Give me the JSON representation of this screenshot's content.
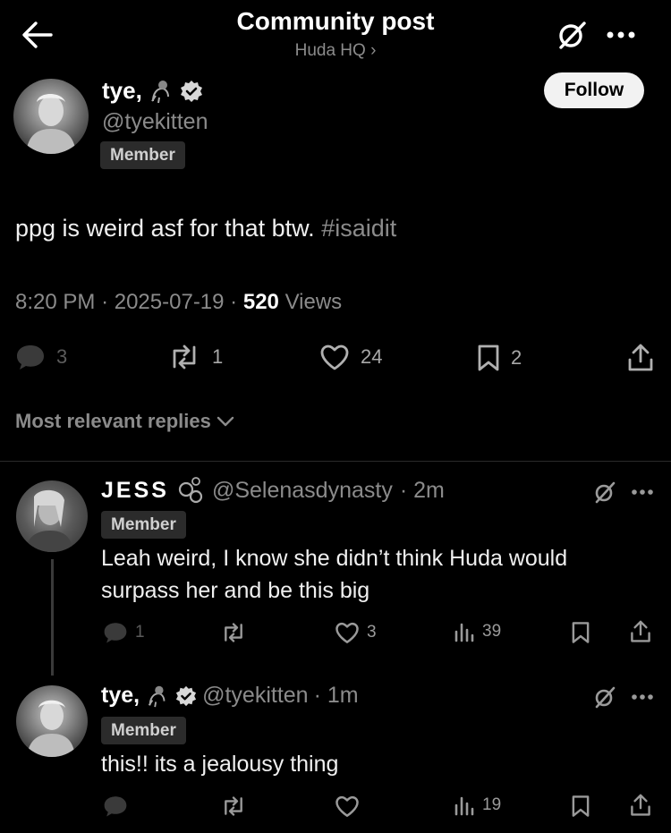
{
  "header": {
    "title": "Community post",
    "subtitle": "Huda HQ ›"
  },
  "post": {
    "display_name": "tye,",
    "handle": "@tyekitten",
    "badge": "Member",
    "follow_label": "Follow",
    "text": "ppg is weird asf for that btw.",
    "hashtag": "#isaidit",
    "time": "8:20 PM",
    "date": "2025-07-19",
    "views_count": "520",
    "views_label": "Views",
    "replies": "3",
    "reposts": "1",
    "likes": "24",
    "bookmarks": "2"
  },
  "replies_section": {
    "label": "Most relevant replies"
  },
  "replies": [
    {
      "display_name": "JESS",
      "handle": "@Selenasdynasty",
      "age": "· 2m",
      "badge": "Member",
      "text_line1": "Leah weird, I know she didn’t think Huda would",
      "text_line2": "surpass her and be this big",
      "replies": "1",
      "likes": "3",
      "views": "39"
    },
    {
      "display_name": "tye,",
      "handle": "@tyekitten",
      "age": "· 1m",
      "badge": "Member",
      "text_line1": "this!! its a jealousy thing",
      "views": "19"
    }
  ]
}
